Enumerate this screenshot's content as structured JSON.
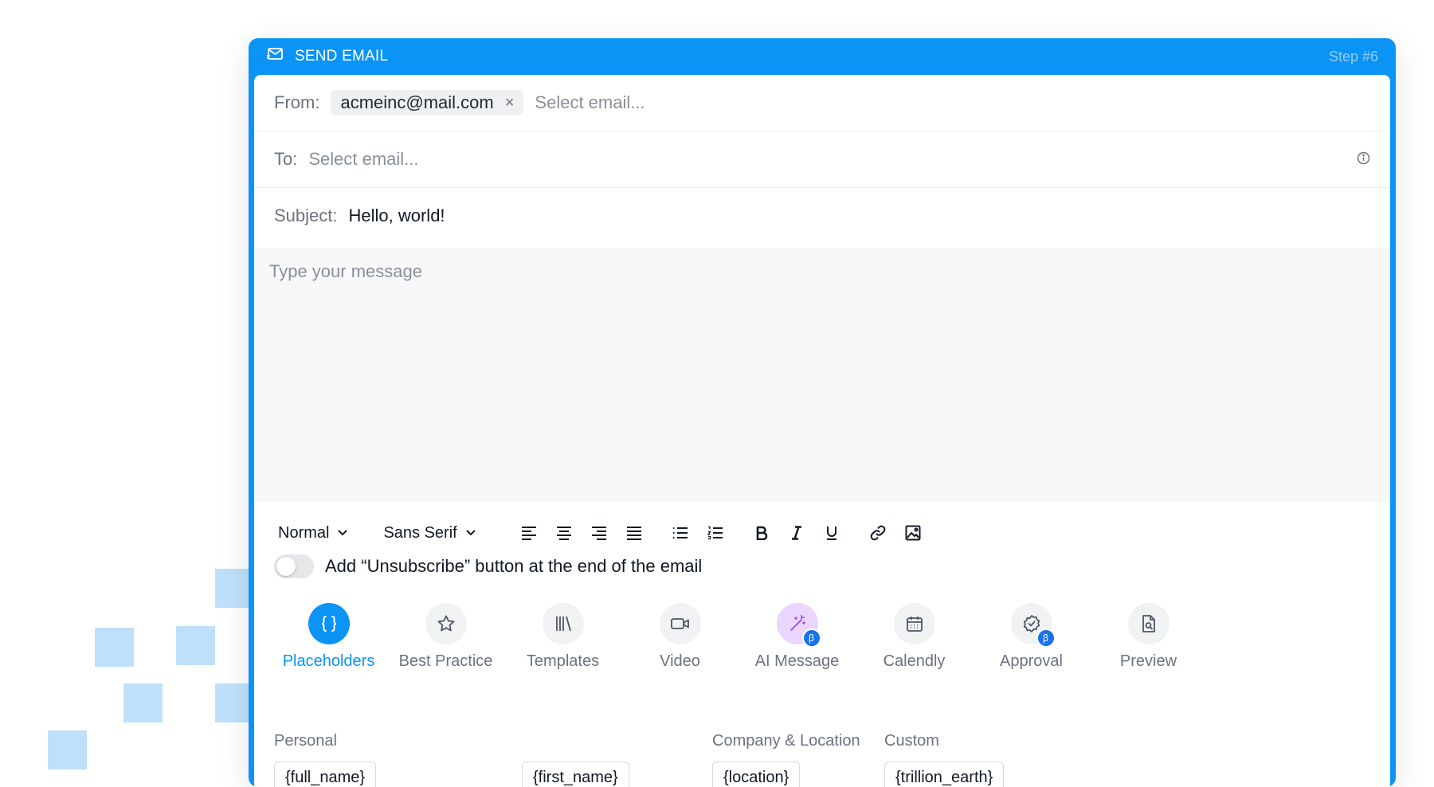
{
  "header": {
    "title": "SEND EMAIL",
    "step": "Step #6"
  },
  "from": {
    "label": "From:",
    "chip": "acmeinc@mail.com",
    "remove_symbol": "×",
    "placeholder": "Select email..."
  },
  "to": {
    "label": "To:",
    "placeholder": "Select email..."
  },
  "subject": {
    "label": "Subject:",
    "value": "Hello, world!"
  },
  "message": {
    "placeholder": "Type your message"
  },
  "toolbar": {
    "text_style": "Normal",
    "font": "Sans Serif"
  },
  "unsubscribe": {
    "label": "Add “Unsubscribe” button at the end of the email",
    "enabled": false
  },
  "tabs": [
    {
      "label": "Placeholders",
      "icon": "braces-icon",
      "active": true
    },
    {
      "label": "Best Practice",
      "icon": "star-icon"
    },
    {
      "label": "Templates",
      "icon": "library-icon"
    },
    {
      "label": "Video",
      "icon": "video-icon"
    },
    {
      "label": "AI Message",
      "icon": "magic-wand-icon",
      "beta": "β"
    },
    {
      "label": "Calendly",
      "icon": "calendar-icon"
    },
    {
      "label": "Approval",
      "icon": "badge-check-icon",
      "beta": "β"
    },
    {
      "label": "Preview",
      "icon": "file-search-icon"
    }
  ],
  "placeholders": {
    "sections": {
      "personal": "Personal",
      "company": "Company & Location",
      "custom": "Custom"
    },
    "items": {
      "full_name": "{full_name}",
      "first_name": "{first_name}",
      "location": "{location}",
      "custom": "{trillion_earth}"
    }
  },
  "colors": {
    "accent": "#0b93f6",
    "beta": "#1a73e8",
    "ai": "#ead6ff"
  }
}
